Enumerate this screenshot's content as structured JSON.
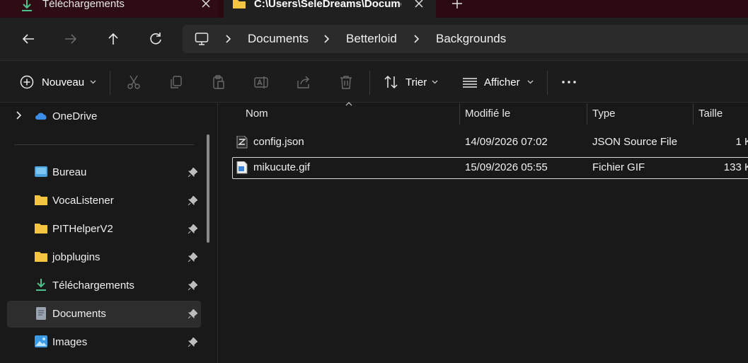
{
  "tabs": [
    {
      "label": "Téléchargements",
      "icon": "download-icon",
      "active": false
    },
    {
      "label": "C:\\Users\\SeleDreams\\Docume",
      "icon": "folder-icon",
      "active": true
    }
  ],
  "address": {
    "crumbs": [
      "Documents",
      "Betterloid",
      "Backgrounds"
    ]
  },
  "toolbar": {
    "new_label": "Nouveau",
    "sort_label": "Trier",
    "view_label": "Afficher"
  },
  "sidebar": {
    "onedrive": "OneDrive",
    "items": [
      {
        "label": "Bureau",
        "icon": "desktop-folder-icon"
      },
      {
        "label": "VocaListener",
        "icon": "folder-icon"
      },
      {
        "label": "PITHelperV2",
        "icon": "folder-icon"
      },
      {
        "label": "jobplugins",
        "icon": "folder-icon"
      },
      {
        "label": "Téléchargements",
        "icon": "download-icon"
      },
      {
        "label": "Documents",
        "icon": "documents-icon",
        "selected": true
      },
      {
        "label": "Images",
        "icon": "images-icon"
      }
    ]
  },
  "columns": {
    "name": "Nom",
    "modified": "Modifié le",
    "type": "Type",
    "size": "Taille"
  },
  "files": [
    {
      "name": "config.json",
      "modified": "14/09/2026 07:02",
      "type": "JSON Source File",
      "size": "1 K",
      "icon": "json-file-icon"
    },
    {
      "name": "mikucute.gif",
      "modified": "15/09/2026 05:55",
      "type": "Fichier GIF",
      "size": "133 K",
      "icon": "gif-file-icon"
    }
  ],
  "colors": {
    "accent": "#4cc2ff",
    "folder": "#f4c542",
    "tabstrip": "#2a0a10"
  }
}
